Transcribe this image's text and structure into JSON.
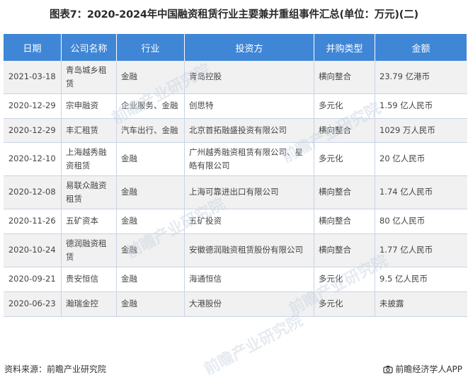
{
  "title": "图表7：2020-2024年中国融资租赁行业主要兼并重组事件汇总(单位：万元)(二)",
  "table": {
    "headers": [
      "日期",
      "公司名称",
      "行业",
      "投资方",
      "并购类型",
      "金额"
    ],
    "rows": [
      [
        "2021-03-18",
        "青岛城乡租赁",
        "金融",
        "青岛控股",
        "横向整合",
        "23.79 亿港币"
      ],
      [
        "2020-12-29",
        "宗申融资",
        "企业服务、金融",
        "创思特",
        "多元化",
        "1.59 亿人民币"
      ],
      [
        "2020-12-29",
        "丰汇租赁",
        "汽车出行、金融",
        "北京首拓融盛投资有限公司",
        "横向整合",
        "1029 万人民币"
      ],
      [
        "2020-12-10",
        "上海越秀融资租赁",
        "金融",
        "广州越秀融资租赁有限公司、星皓有限公司",
        "多元化",
        "20 亿人民币"
      ],
      [
        "2020-12-08",
        "易联众融资租赁",
        "金融",
        "上海可靠进出口有限公司",
        "横向整合",
        "1.74 亿人民币"
      ],
      [
        "2020-11-26",
        "五矿资本",
        "金融",
        "五矿投资",
        "横向整合",
        "80 亿人民币"
      ],
      [
        "2020-10-24",
        "德润融资租赁",
        "金融",
        "安徽德润融资租赁股份有限公司",
        "横向整合",
        "1.77 亿人民币"
      ],
      [
        "2020-09-21",
        "贵安恒信",
        "金融",
        "海通恒信",
        "多元化",
        "9.5 亿人民币"
      ],
      [
        "2020-06-23",
        "瀚瑞金控",
        "金融",
        "大港股份",
        "多元化",
        "未披露"
      ]
    ]
  },
  "watermark": "前瞻产业研究院",
  "footer": {
    "source": "资料来源：前瞻产业研究院",
    "app": "前瞻经济学人APP",
    "app_icon": "camera-icon"
  }
}
